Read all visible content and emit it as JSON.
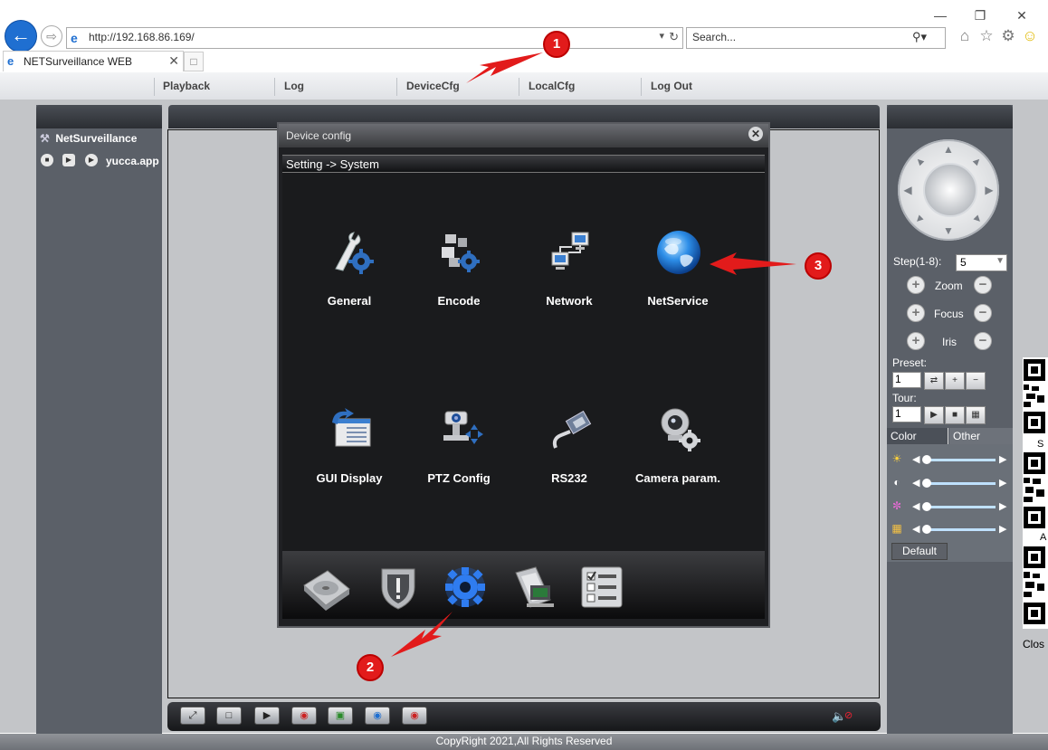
{
  "browser": {
    "url": "http://192.168.86.169/",
    "search_placeholder": "Search...",
    "tab_title": "NETSurveillance WEB"
  },
  "menu": {
    "items": [
      "Playback",
      "Log",
      "DeviceCfg",
      "LocalCfg",
      "Log Out"
    ]
  },
  "device_tree": {
    "root": "NetSurveillance",
    "device": "yucca.app"
  },
  "ptz": {
    "step_label": "Step(1-8):",
    "step_value": "5",
    "zoom_label": "Zoom",
    "focus_label": "Focus",
    "iris_label": "Iris",
    "preset_label": "Preset:",
    "preset_value": "1",
    "tour_label": "Tour:",
    "tour_value": "1",
    "tab_color": "Color",
    "tab_other": "Other",
    "default_label": "Default",
    "slider_levels": [
      0.05,
      0.05,
      0.05,
      0.05
    ]
  },
  "qr_strip": {
    "label_s": "S",
    "label_a": "A",
    "label_close": "Clos"
  },
  "dialog": {
    "title": "Device config",
    "breadcrumb": "Setting -> System",
    "items": [
      {
        "label": "General",
        "icon": "wrench-gear-icon"
      },
      {
        "label": "Encode",
        "icon": "blocks-gear-icon"
      },
      {
        "label": "Network",
        "icon": "network-computers-icon"
      },
      {
        "label": "NetService",
        "icon": "globe-icon"
      },
      {
        "label": "GUI Display",
        "icon": "display-window-icon"
      },
      {
        "label": "PTZ Config",
        "icon": "ptz-camera-icon"
      },
      {
        "label": "RS232",
        "icon": "serial-cable-icon"
      },
      {
        "label": "Camera param.",
        "icon": "camera-gear-icon"
      }
    ],
    "bottom_icons": [
      "hard-disk-icon",
      "alarm-shield-icon",
      "system-gear-icon",
      "advanced-tools-icon",
      "info-list-icon"
    ]
  },
  "footer": {
    "copyright": "CopyRight 2021,All Rights Reserved"
  },
  "annotations": {
    "badge1": "1",
    "badge2": "2",
    "badge3": "3"
  },
  "colors": {
    "annotation_red": "#e21b1b",
    "accent_blue": "#1f6fd1",
    "dialog_bg": "#1a1b1d"
  }
}
